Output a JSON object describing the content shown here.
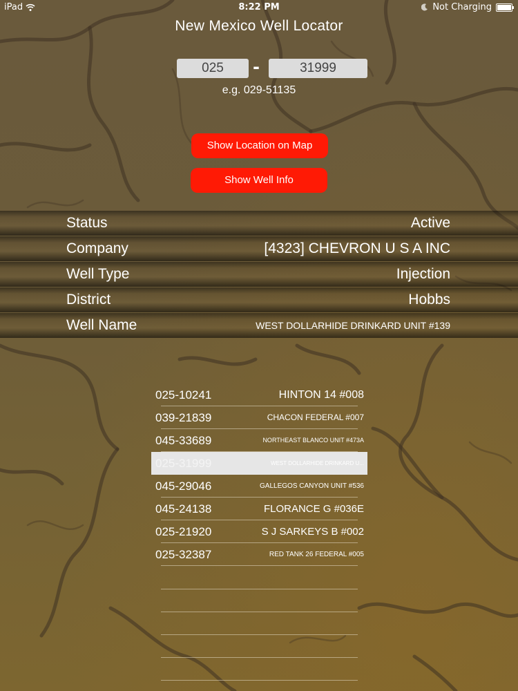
{
  "status_bar": {
    "device": "iPad",
    "time": "8:22 PM",
    "charging": "Not Charging",
    "battery_level": 1.0
  },
  "title": "New Mexico Well Locator",
  "api_input": {
    "county_code": "025",
    "well_number": "31999",
    "separator": "-",
    "example": "e.g. 029-51135"
  },
  "buttons": {
    "show_map": "Show Location on Map",
    "show_info": "Show Well Info"
  },
  "well_info": [
    {
      "label": "Status",
      "value": "Active"
    },
    {
      "label": "Company",
      "value": "[4323] CHEVRON U S A INC"
    },
    {
      "label": "Well Type",
      "value": "Injection"
    },
    {
      "label": "District",
      "value": "Hobbs"
    },
    {
      "label": "Well Name",
      "value": "WEST DOLLARHIDE DRINKARD UNIT #139"
    }
  ],
  "history": [
    {
      "api": "025-10241",
      "name": "HINTON 14 #008"
    },
    {
      "api": "039-21839",
      "name": "CHACON FEDERAL #007"
    },
    {
      "api": "045-33689",
      "name": "NORTHEAST BLANCO UNIT #473A"
    },
    {
      "api": "025-31999",
      "name": "WEST DOLLARHIDE DRINKARD U..."
    },
    {
      "api": "045-29046",
      "name": "GALLEGOS CANYON UNIT #536"
    },
    {
      "api": "045-24138",
      "name": "FLORANCE G #036E"
    },
    {
      "api": "025-21920",
      "name": "S J SARKEYS B #002"
    },
    {
      "api": "025-32387",
      "name": "RED TANK 26 FEDERAL #005"
    }
  ],
  "colors": {
    "button_red": "#ff1a05",
    "background": "#6b5b3a",
    "selected_row": "#e6e6e6"
  },
  "icons": {
    "wifi": "wifi-icon",
    "moon": "moon-icon",
    "battery": "battery-icon"
  }
}
